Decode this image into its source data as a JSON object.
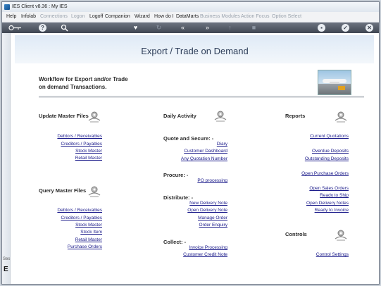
{
  "window": {
    "title": "IES Client v8.36 : My IES"
  },
  "menu": [
    {
      "label": "Help",
      "enabled": true
    },
    {
      "label": "Infolab",
      "enabled": true
    },
    {
      "label": "Connections",
      "enabled": false
    },
    {
      "label": "Logon",
      "enabled": false
    },
    {
      "label": "Logoff",
      "enabled": true
    },
    {
      "label": "Companion",
      "enabled": true
    },
    {
      "label": "Wizard",
      "enabled": true
    },
    {
      "label": "How do I",
      "enabled": true
    },
    {
      "label": "DataMarts",
      "enabled": true
    },
    {
      "label": "Business Modules",
      "enabled": false
    },
    {
      "label": "Action Focus",
      "enabled": false
    },
    {
      "label": "Option Select",
      "enabled": false
    }
  ],
  "toolbar": {
    "icons": [
      "key-icon",
      "help-icon",
      "search-icon",
      "heart-icon",
      "refresh-icon",
      "rewind-icon",
      "forward-icon",
      "upload-icon",
      "stop-icon",
      "print-icon",
      "check-icon",
      "close-icon"
    ]
  },
  "sidebar": {
    "label1": "Ses",
    "label2": "E"
  },
  "page": {
    "title": "Export / Trade on Demand",
    "intro_line1": "Workflow for Export and/or Trade",
    "intro_line2": "on demand Transactions."
  },
  "update_master": {
    "heading": "Update Master Files",
    "links": [
      "Debtors / Receivables",
      "Creditors / Payables",
      "Stock Master",
      "Retail Master"
    ]
  },
  "query_master": {
    "heading": "Query Master Files",
    "links": [
      "Debtors / Receivables",
      "Creditors / Payables",
      "Stock Master",
      "Stock Item",
      "Retail Master",
      "Purchase Orders"
    ]
  },
  "daily": {
    "heading": "Daily Activity",
    "quote_heading": "Quote and Secure: -",
    "quote_links": [
      "Diary",
      "Customer Dashboard",
      "Any Quotation Number"
    ],
    "procure_heading": "Procure: -",
    "procure_links": [
      "PO processing"
    ],
    "distribute_heading": "Distribute: -",
    "distribute_links": [
      "New Delivery Note",
      "Open Delivery Note",
      "Manage Order",
      "Order Enquiry"
    ],
    "collect_heading": "Collect: -",
    "collect_links": [
      "Invoice Processing",
      "Customer Credit Note"
    ]
  },
  "reports": {
    "heading": "Reports",
    "links": [
      "Current Quotations",
      "Overdue Deposits",
      "Outstanding Deposits",
      "Open Purchase Orders",
      "Open Sales Orders",
      "Ready to Ship",
      "Open Delivery Notes",
      "Ready to Invoice"
    ]
  },
  "controls": {
    "heading": "Controls",
    "links": [
      "Control Settings"
    ]
  }
}
